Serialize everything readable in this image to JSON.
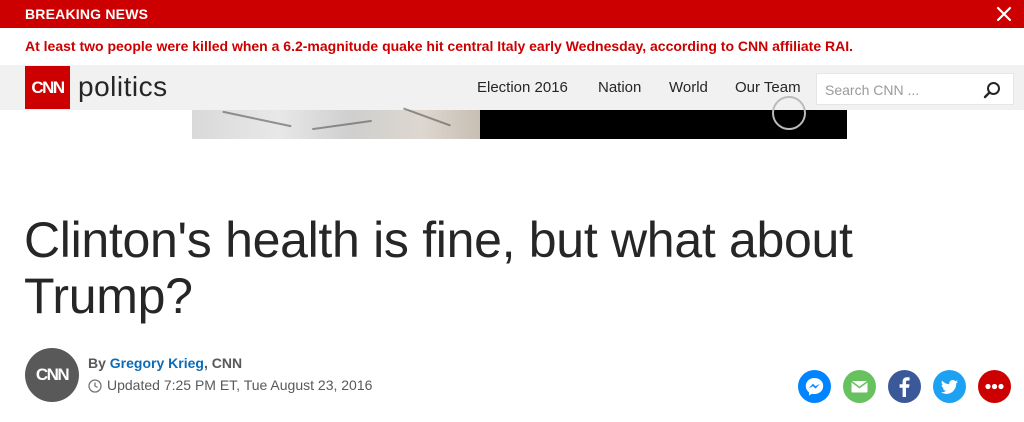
{
  "breaking": {
    "label": "BREAKING NEWS",
    "message": "At least two people were killed when a 6.2-magnitude quake hit central Italy early Wednesday, according to CNN affiliate RAI.",
    "close_icon": "close-icon"
  },
  "nav": {
    "logo_text": "CNN",
    "section": "politics",
    "links": [
      "Election 2016",
      "Nation",
      "World",
      "Our Team"
    ],
    "search_placeholder": "Search CNN ...",
    "search_icon": "search-icon"
  },
  "article": {
    "headline": "Clinton's health is fine, but what about Trump?",
    "byline_prefix": "By ",
    "author": "Gregory Krieg",
    "source": ", CNN",
    "avatar_text": "CNN",
    "updated": "Updated 7:25 PM ET, Tue August 23, 2016"
  },
  "share": [
    {
      "name": "messenger",
      "color": "#0084ff",
      "icon": "messenger-icon"
    },
    {
      "name": "email",
      "color": "#67c15e",
      "icon": "email-icon"
    },
    {
      "name": "facebook",
      "color": "#3b5998",
      "icon": "facebook-icon"
    },
    {
      "name": "twitter",
      "color": "#1da1f2",
      "icon": "twitter-icon"
    },
    {
      "name": "more",
      "color": "#cc0000",
      "icon": "more-icon"
    }
  ],
  "colors": {
    "brand": "#cc0000",
    "link": "#0c6cb8"
  }
}
